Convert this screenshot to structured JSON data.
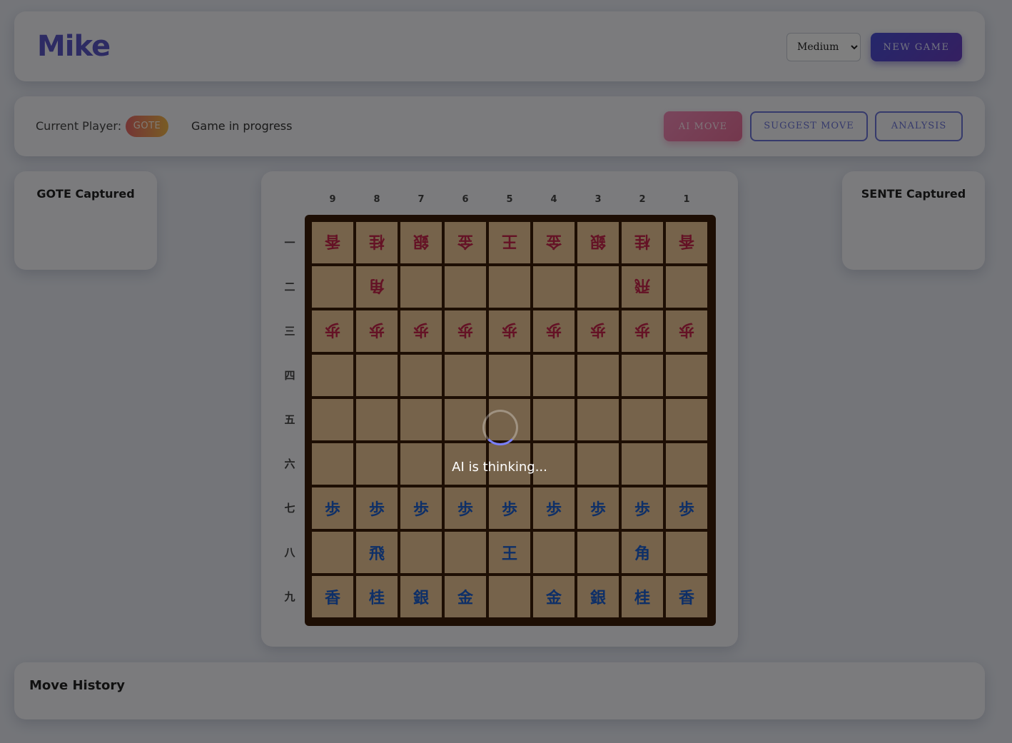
{
  "header": {
    "title": "Mike",
    "difficulty": {
      "selected": "Medium",
      "options": [
        "Medium"
      ]
    },
    "new_game_label": "NEW GAME"
  },
  "status_bar": {
    "current_player_label": "Current Player:",
    "current_player": "GOTE",
    "game_status": "Game in progress",
    "ai_move_label": "AI MOVE",
    "suggest_move_label": "SUGGEST MOVE",
    "analysis_label": "ANALYSIS"
  },
  "captured": {
    "gote_title": "GOTE Captured",
    "sente_title": "SENTE Captured"
  },
  "board": {
    "files": [
      "9",
      "8",
      "7",
      "6",
      "5",
      "4",
      "3",
      "2",
      "1"
    ],
    "ranks": [
      "一",
      "二",
      "三",
      "四",
      "五",
      "六",
      "七",
      "八",
      "九"
    ],
    "rows": [
      [
        {
          "p": "香",
          "s": "gote"
        },
        {
          "p": "桂",
          "s": "gote"
        },
        {
          "p": "銀",
          "s": "gote"
        },
        {
          "p": "金",
          "s": "gote"
        },
        {
          "p": "王",
          "s": "gote"
        },
        {
          "p": "金",
          "s": "gote"
        },
        {
          "p": "銀",
          "s": "gote"
        },
        {
          "p": "桂",
          "s": "gote"
        },
        {
          "p": "香",
          "s": "gote"
        }
      ],
      [
        null,
        {
          "p": "角",
          "s": "gote"
        },
        null,
        null,
        null,
        null,
        null,
        {
          "p": "飛",
          "s": "gote"
        },
        null
      ],
      [
        {
          "p": "歩",
          "s": "gote"
        },
        {
          "p": "歩",
          "s": "gote"
        },
        {
          "p": "歩",
          "s": "gote"
        },
        {
          "p": "歩",
          "s": "gote"
        },
        {
          "p": "歩",
          "s": "gote"
        },
        {
          "p": "歩",
          "s": "gote"
        },
        {
          "p": "歩",
          "s": "gote"
        },
        {
          "p": "歩",
          "s": "gote"
        },
        {
          "p": "歩",
          "s": "gote"
        }
      ],
      [
        null,
        null,
        null,
        null,
        null,
        null,
        null,
        null,
        null
      ],
      [
        null,
        null,
        null,
        null,
        null,
        null,
        null,
        null,
        null
      ],
      [
        null,
        null,
        null,
        null,
        null,
        null,
        null,
        null,
        null
      ],
      [
        {
          "p": "歩",
          "s": "sente"
        },
        {
          "p": "歩",
          "s": "sente"
        },
        {
          "p": "歩",
          "s": "sente"
        },
        {
          "p": "歩",
          "s": "sente"
        },
        {
          "p": "歩",
          "s": "sente"
        },
        {
          "p": "歩",
          "s": "sente"
        },
        {
          "p": "歩",
          "s": "sente"
        },
        {
          "p": "歩",
          "s": "sente"
        },
        {
          "p": "歩",
          "s": "sente"
        }
      ],
      [
        null,
        {
          "p": "飛",
          "s": "sente"
        },
        null,
        null,
        {
          "p": "王",
          "s": "sente"
        },
        null,
        null,
        {
          "p": "角",
          "s": "sente"
        },
        null
      ],
      [
        {
          "p": "香",
          "s": "sente"
        },
        {
          "p": "桂",
          "s": "sente"
        },
        {
          "p": "銀",
          "s": "sente"
        },
        {
          "p": "金",
          "s": "sente"
        },
        null,
        {
          "p": "金",
          "s": "sente"
        },
        {
          "p": "銀",
          "s": "sente"
        },
        {
          "p": "桂",
          "s": "sente"
        },
        {
          "p": "香",
          "s": "sente"
        }
      ]
    ]
  },
  "overlay": {
    "message": "AI is thinking..."
  },
  "move_history": {
    "title": "Move History"
  }
}
